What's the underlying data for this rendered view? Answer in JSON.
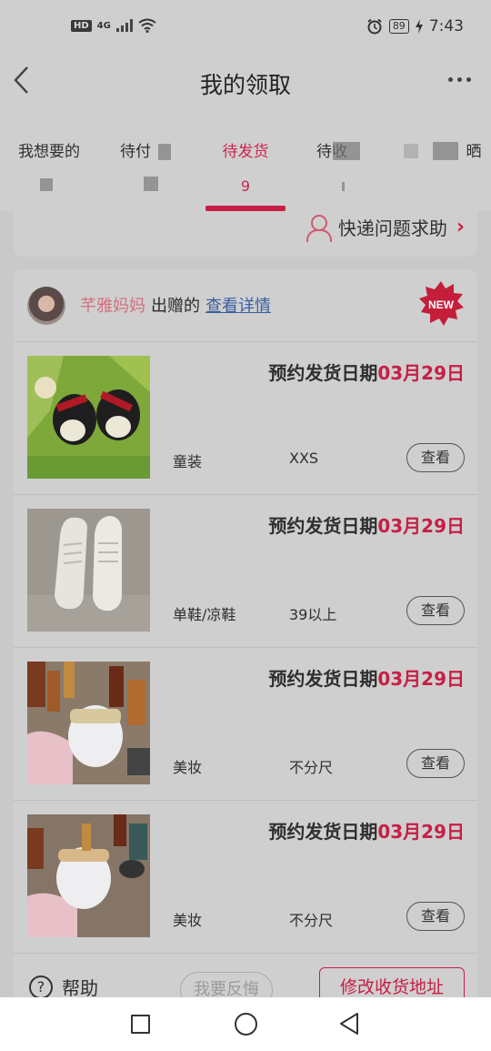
{
  "status_bar": {
    "hd": "HD",
    "network": "4G",
    "battery": "89",
    "time": "7:43"
  },
  "header": {
    "title": "我的领取"
  },
  "tabs": [
    {
      "label": "我想要的",
      "count": ""
    },
    {
      "label": "待付",
      "count": ""
    },
    {
      "label": "待发货",
      "count": "9"
    },
    {
      "label": "待收",
      "count": ""
    },
    {
      "label": "晒",
      "count": ""
    }
  ],
  "help_card": {
    "label": "快递问题求助"
  },
  "order": {
    "giver_name": "芊雅妈妈",
    "giver_action": "出赠的",
    "detail_link": "查看详情",
    "new_badge": "NEW",
    "items": [
      {
        "date_prefix": "预约发货日期",
        "date": "03月29日",
        "category": "童装",
        "size": "XXS",
        "view": "查看"
      },
      {
        "date_prefix": "预约发货日期",
        "date": "03月29日",
        "category": "单鞋/凉鞋",
        "size": "39以上",
        "view": "查看"
      },
      {
        "date_prefix": "预约发货日期",
        "date": "03月29日",
        "category": "美妆",
        "size": "不分尺",
        "view": "查看"
      },
      {
        "date_prefix": "预约发货日期",
        "date": "03月29日",
        "category": "美妆",
        "size": "不分尺",
        "view": "查看"
      }
    ],
    "footer": {
      "help": "帮助",
      "regret": "我要反悔",
      "change_address": "修改收货地址"
    }
  },
  "colors": {
    "accent": "#c71e45",
    "link": "#3a5fa0",
    "overlay_bg": "#cfcfcf"
  }
}
